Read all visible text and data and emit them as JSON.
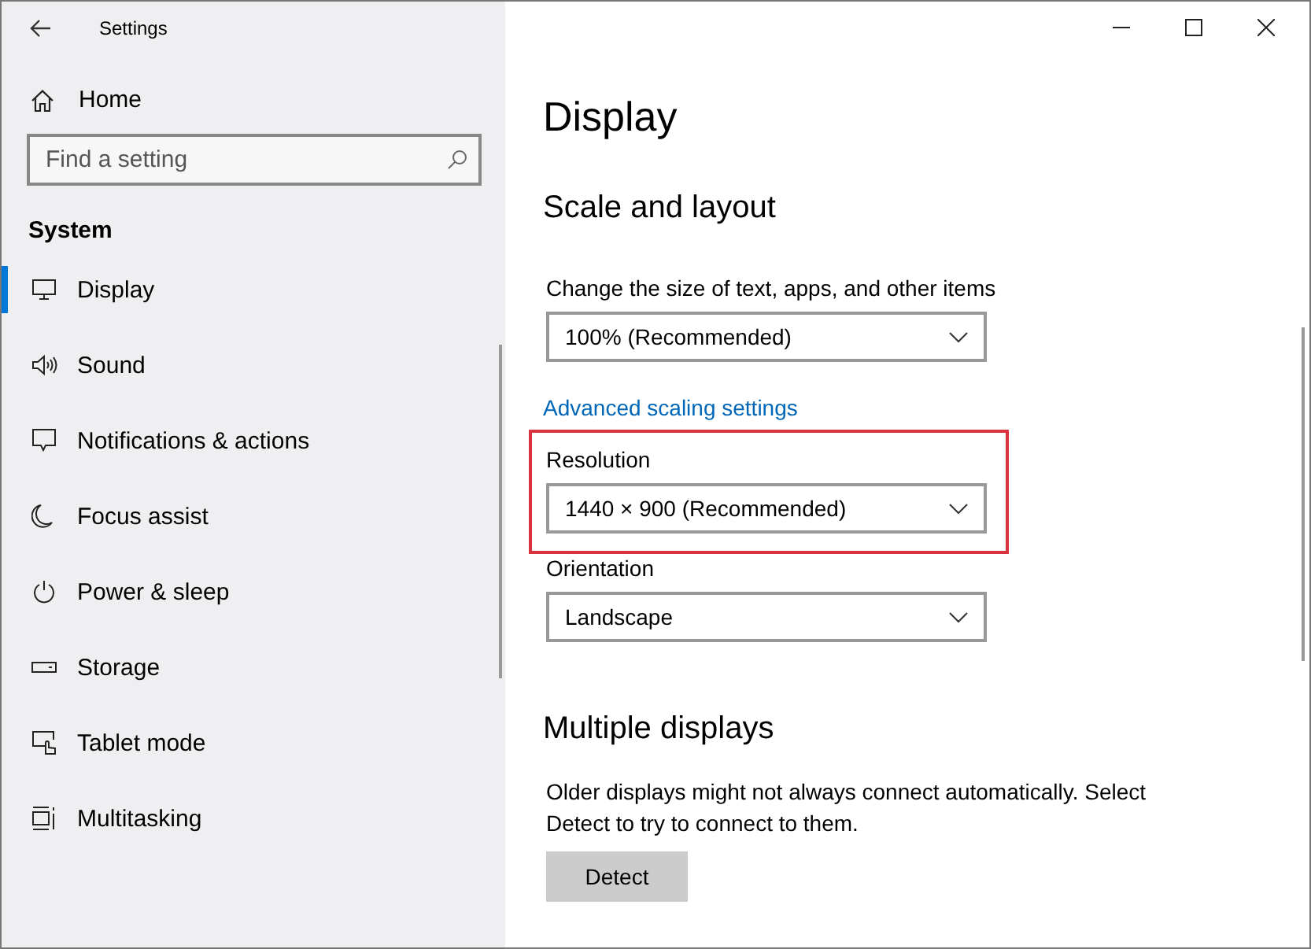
{
  "window": {
    "title": "Settings"
  },
  "sidebar": {
    "home": "Home",
    "search": {
      "placeholder": "Find a setting"
    },
    "section": "System",
    "items": [
      {
        "label": "Display",
        "selected": true
      },
      {
        "label": "Sound",
        "selected": false
      },
      {
        "label": "Notifications & actions",
        "selected": false
      },
      {
        "label": "Focus assist",
        "selected": false
      },
      {
        "label": "Power & sleep",
        "selected": false
      },
      {
        "label": "Storage",
        "selected": false
      },
      {
        "label": "Tablet mode",
        "selected": false
      },
      {
        "label": "Multitasking",
        "selected": false
      }
    ]
  },
  "page": {
    "title": "Display",
    "sections": [
      {
        "heading": "Scale and layout",
        "settings": [
          {
            "kind": "dropdown",
            "label": "Change the size of text, apps, and other items",
            "value": "100% (Recommended)",
            "highlighted": false
          },
          {
            "kind": "link",
            "label": "Advanced scaling settings"
          },
          {
            "kind": "dropdown",
            "label": "Resolution",
            "value": "1440 × 900 (Recommended)",
            "highlighted": true
          },
          {
            "kind": "dropdown",
            "label": "Orientation",
            "value": "Landscape",
            "highlighted": false
          }
        ]
      },
      {
        "heading": "Multiple displays",
        "settings": [
          {
            "kind": "text",
            "text": "Older displays might not always connect automatically. Select Detect to try to connect to them."
          },
          {
            "kind": "button",
            "label": "Detect"
          }
        ]
      }
    ]
  }
}
